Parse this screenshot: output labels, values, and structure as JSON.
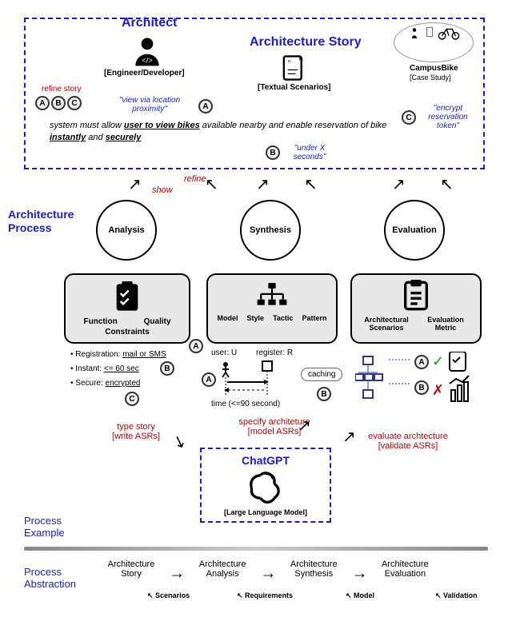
{
  "top": {
    "architect_title": "Architect",
    "architect_sub": "[Engineer/Developer]",
    "story_title": "Architecture Story",
    "case_name": "CampusBike",
    "case_sub": "[Case Study]",
    "textual_scen": "[Textual Scenarios]",
    "refine_story": "refine story",
    "note_a": "\"view via location proximity\"",
    "req_pre": "system must allow ",
    "req_u1": "user to view bikes",
    "req_mid": " available nearby and enable reservation of bike ",
    "req_u2": "instantly",
    "req_and": " and ",
    "req_u3": "securely",
    "note_b": "\"under X seconds\"",
    "note_c": "\"encrypt reservation token\"",
    "markers": {
      "a": "A",
      "b": "B",
      "c": "C"
    }
  },
  "proc_label": "Architecture Process",
  "show": "show",
  "refine": "refine",
  "circles": {
    "analysis": "Analysis",
    "synthesis": "Synthesis",
    "evaluation": "Evaluation"
  },
  "analysis_box": {
    "function": "Function",
    "quality": "Quality",
    "constraints": "Constraints",
    "r1_pre": "Registration: ",
    "r1_u": "mail or SMS",
    "r2_pre": "Instant: ",
    "r2_u": "<= 60 sec",
    "r3_pre": "Secure: ",
    "r3_u": "encrypted"
  },
  "synthesis_box": {
    "model": "Model",
    "style": "Style",
    "tactic": "Tactic",
    "pattern": "Pattern",
    "user": "user: U",
    "register": "register: R",
    "time": "time (<=90 second)",
    "caching": "caching"
  },
  "eval_box": {
    "scenarios": "Architectural Scenarios",
    "metric": "Evaluation Metric"
  },
  "actions": {
    "type_story": "type story",
    "type_story_sub": "[write ASRs]",
    "specify": "specify architeture",
    "specify_sub": "[model ASRs]",
    "evaluate": "evaluate archtecture",
    "evaluate_sub": "[validate ASRs]"
  },
  "chatgpt": {
    "title": "ChatGPT",
    "sub": "[Large Language Model]"
  },
  "legend": {
    "example": "Process Example",
    "abstraction": "Process Abstraction"
  },
  "abstraction": {
    "story": "Architecture Story",
    "analysis": "Architecture Analysis",
    "synthesis": "Architecture Synthesis",
    "evaluation": "Architecture Evaluation",
    "scenarios": "Scenarios",
    "requirements": "Requirements",
    "model": "Model",
    "validation": "Validation"
  }
}
